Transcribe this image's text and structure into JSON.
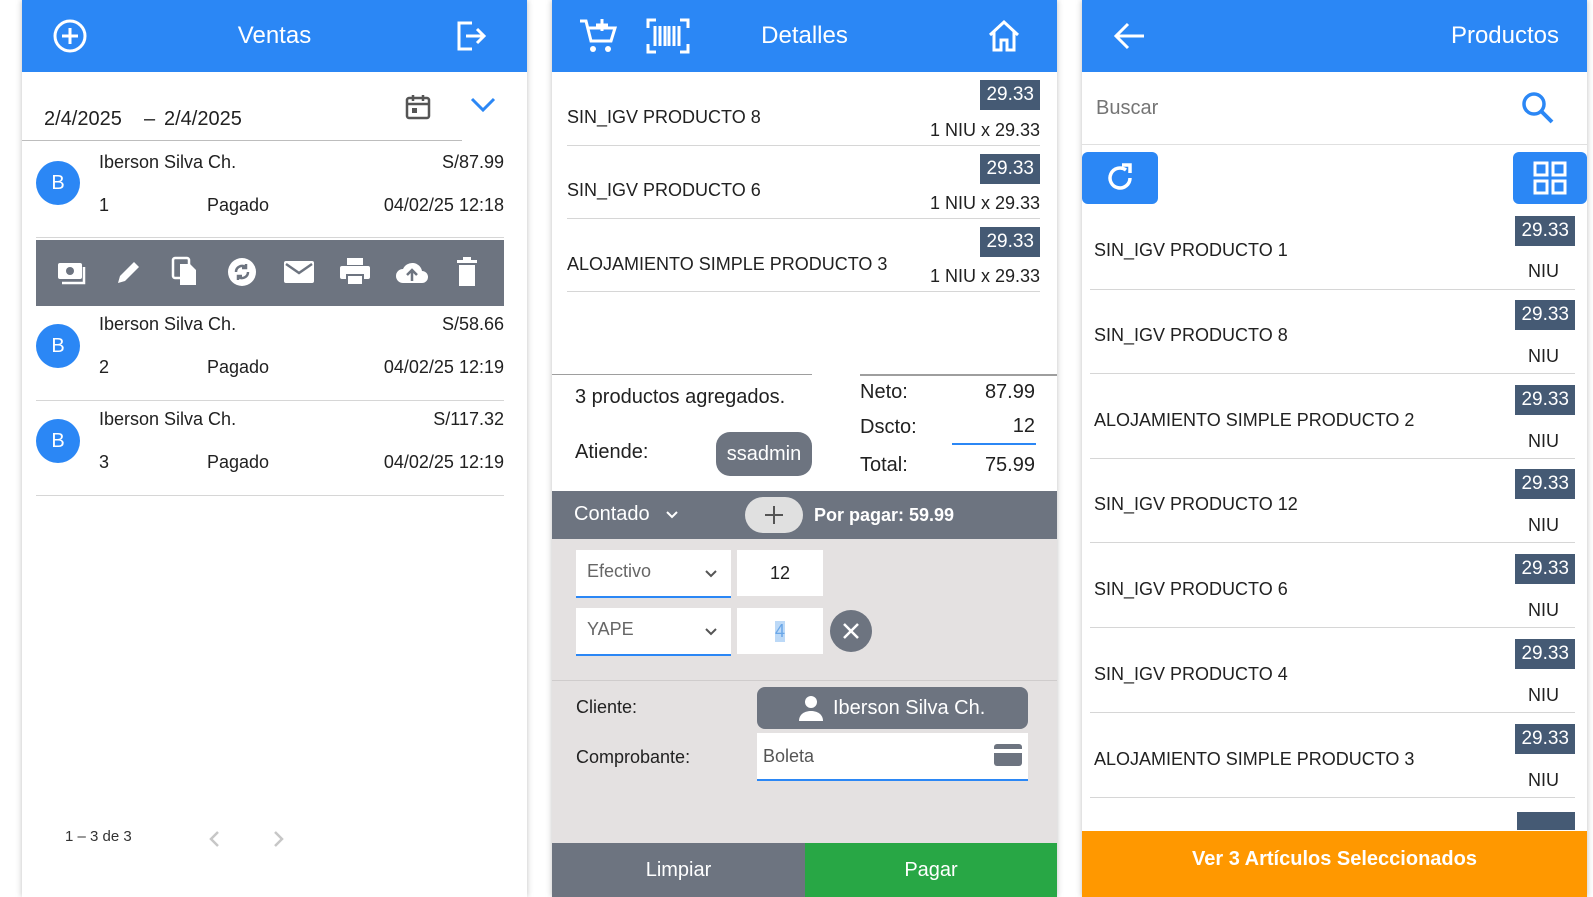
{
  "ventas": {
    "title": "Ventas",
    "date_from": "2/4/2025",
    "date_sep": "–",
    "date_to": "2/4/2025",
    "sales": [
      {
        "avatar": "B",
        "customer": "Iberson Silva Ch.",
        "amount": "S/87.99",
        "number": "1",
        "status": "Pagado",
        "datetime": "04/02/25 12:18"
      },
      {
        "avatar": "B",
        "customer": "Iberson Silva Ch.",
        "amount": "S/58.66",
        "number": "2",
        "status": "Pagado",
        "datetime": "04/02/25 12:19"
      },
      {
        "avatar": "B",
        "customer": "Iberson Silva Ch.",
        "amount": "S/117.32",
        "number": "3",
        "status": "Pagado",
        "datetime": "04/02/25 12:19"
      }
    ],
    "action_icons": [
      "cash-icon",
      "edit-icon",
      "copy-icon",
      "sync-icon",
      "mail-icon",
      "print-icon",
      "upload-icon",
      "delete-icon"
    ],
    "paginator": "1 – 3 de 3"
  },
  "detalles": {
    "title": "Detalles",
    "items": [
      {
        "name": "SIN_IGV PRODUCTO 8",
        "total": "29.33",
        "qty_line": "1 NIU x 29.33"
      },
      {
        "name": "SIN_IGV PRODUCTO 6",
        "total": "29.33",
        "qty_line": "1 NIU x 29.33"
      },
      {
        "name": "ALOJAMIENTO SIMPLE PRODUCTO 3",
        "total": "29.33",
        "qty_line": "1 NIU x 29.33"
      }
    ],
    "summary_text": "3 productos agregados.",
    "atiende_label": "Atiende:",
    "atiende_user": "ssadmin",
    "neto_label": "Neto:",
    "neto_value": "87.99",
    "dscto_label": "Dscto:",
    "dscto_value": "12",
    "total_label": "Total:",
    "total_value": "75.99",
    "payment_type": "Contado",
    "por_pagar": "Por pagar: 59.99",
    "payments": [
      {
        "method": "Efectivo",
        "amount": "12"
      },
      {
        "method": "YAPE",
        "amount": "4"
      }
    ],
    "cliente_label": "Cliente:",
    "cliente_value": "Iberson Silva Ch.",
    "comprobante_label": "Comprobante:",
    "comprobante_value": "Boleta",
    "limpiar_label": "Limpiar",
    "pagar_label": "Pagar"
  },
  "productos": {
    "title": "Productos",
    "search_placeholder": "Buscar",
    "items": [
      {
        "name": "SIN_IGV PRODUCTO 1",
        "price": "29.33",
        "unit": "NIU"
      },
      {
        "name": "SIN_IGV PRODUCTO 8",
        "price": "29.33",
        "unit": "NIU"
      },
      {
        "name": "ALOJAMIENTO SIMPLE PRODUCTO 2",
        "price": "29.33",
        "unit": "NIU"
      },
      {
        "name": "SIN_IGV PRODUCTO 12",
        "price": "29.33",
        "unit": "NIU"
      },
      {
        "name": "SIN_IGV PRODUCTO 6",
        "price": "29.33",
        "unit": "NIU"
      },
      {
        "name": "SIN_IGV PRODUCTO 4",
        "price": "29.33",
        "unit": "NIU"
      },
      {
        "name": "ALOJAMIENTO SIMPLE PRODUCTO 3",
        "price": "29.33",
        "unit": "NIU"
      }
    ],
    "footer_button": "Ver 3 Artículos Seleccionados"
  },
  "colors": {
    "primary": "#2b87f5",
    "dark_badge": "#455a74",
    "toolbar_gray": "#6d7480",
    "pay_green": "#28a745",
    "orange": "#ff9800"
  }
}
